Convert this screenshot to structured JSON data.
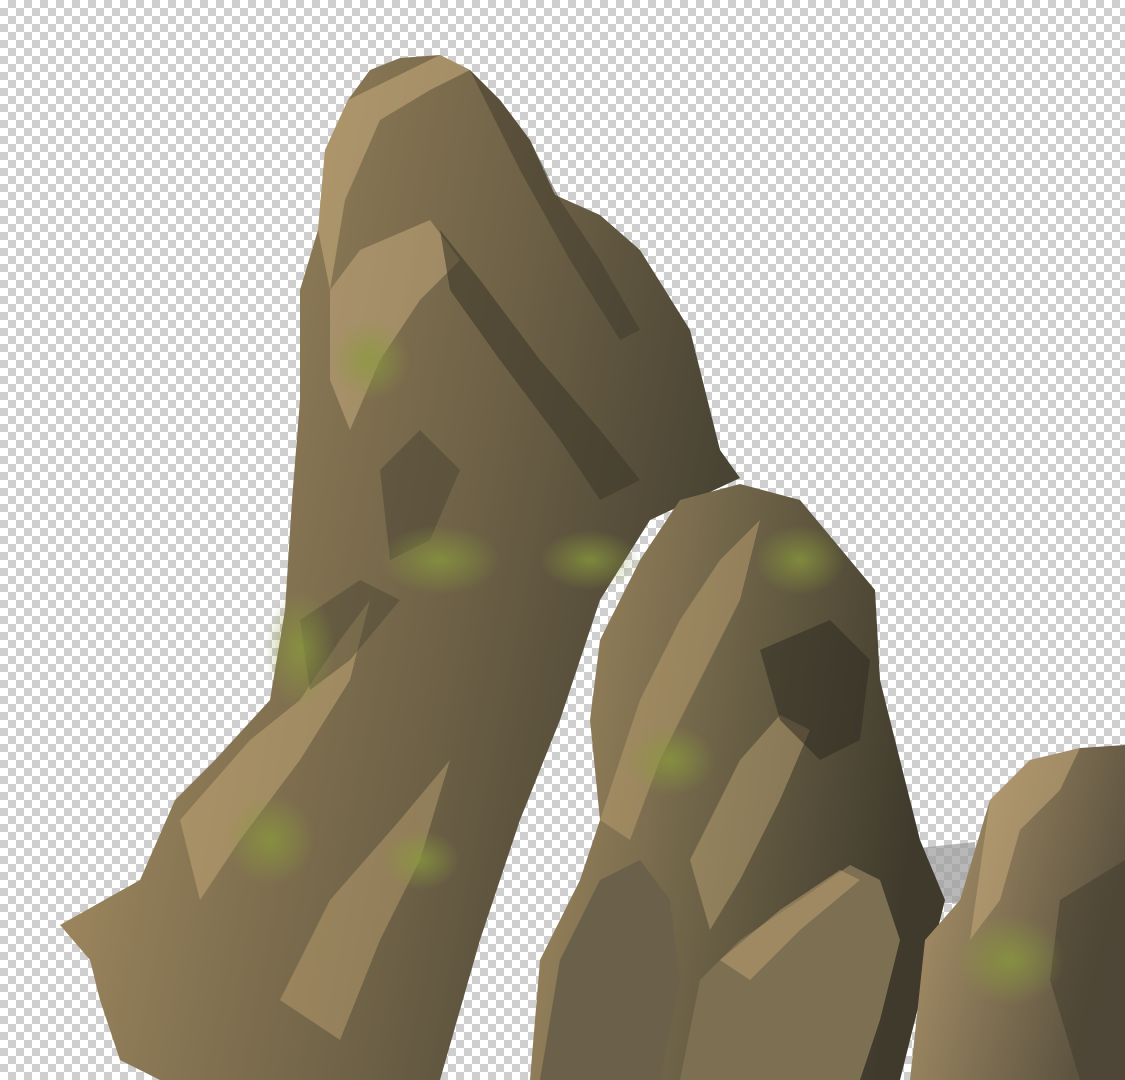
{
  "image": {
    "subject": "rock-formation",
    "background": "transparency-checkerboard",
    "colors": {
      "checker_light": "#ffffff",
      "checker_dark": "#cfcfcf",
      "rock_highlight": "#c9ad7e",
      "rock_mid": "#8a7654",
      "rock_shadow": "#3f3a2c",
      "moss": "#7d8a3a",
      "ground_shadow": "#9a9a9a"
    }
  }
}
